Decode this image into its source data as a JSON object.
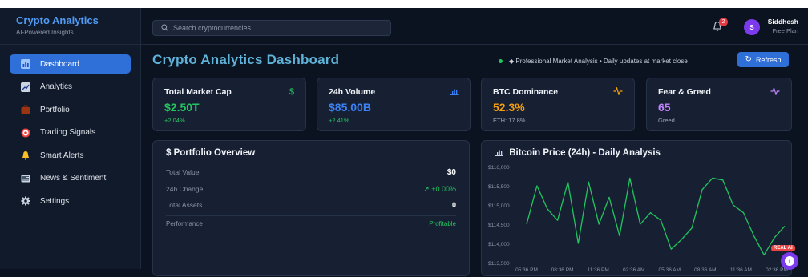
{
  "brand": {
    "title": "Crypto Analytics",
    "subtitle": "AI-Powered Insights"
  },
  "sidebar": {
    "items": [
      {
        "label": "Dashboard",
        "icon": "bar-chart-icon",
        "active": true
      },
      {
        "label": "Analytics",
        "icon": "trend-chart-icon"
      },
      {
        "label": "Portfolio",
        "icon": "briefcase-icon"
      },
      {
        "label": "Trading Signals",
        "icon": "target-icon"
      },
      {
        "label": "Smart Alerts",
        "icon": "bell-icon"
      },
      {
        "label": "News & Sentiment",
        "icon": "newspaper-icon"
      },
      {
        "label": "Settings",
        "icon": "gear-icon"
      }
    ]
  },
  "topbar": {
    "search_placeholder": "Search cryptocurrencies...",
    "notification_count": "2",
    "user": {
      "initial": "S",
      "name": "Siddhesh",
      "plan": "Free Plan"
    }
  },
  "header": {
    "title": "Crypto Analytics Dashboard",
    "market_note": "◆ Professional Market Analysis • Daily updates at market close",
    "refresh_label": "Refresh"
  },
  "stats": [
    {
      "title": "Total Market Cap",
      "icon": "dollar-icon",
      "value": "$2.50T",
      "sub": "+2.04%",
      "value_color": "#22c55e",
      "sub_color": "#22c55e",
      "icon_color": "#22c55e"
    },
    {
      "title": "24h Volume",
      "icon": "bar-chart-icon",
      "value": "$85.00B",
      "sub": "+2.41%",
      "value_color": "#3b82f6",
      "sub_color": "#22c55e",
      "icon_color": "#3b82f6"
    },
    {
      "title": "BTC Dominance",
      "icon": "activity-icon",
      "value": "52.3%",
      "sub": "ETH: 17.8%",
      "value_color": "#f59e0b",
      "sub_color": "#9aa4b6",
      "icon_color": "#f59e0b"
    },
    {
      "title": "Fear & Greed",
      "icon": "activity-icon",
      "value": "65",
      "sub": "Greed",
      "value_color": "#c084fc",
      "sub_color": "#9aa4b6",
      "icon_color": "#c084fc"
    }
  ],
  "portfolio": {
    "title": "$  Portfolio Overview",
    "rows": [
      {
        "label": "Total Value",
        "value": "$0"
      },
      {
        "label": "24h Change",
        "value": "↗ +0.00%"
      },
      {
        "label": "Total Assets",
        "value": "0"
      }
    ],
    "performance_label": "Performance",
    "performance_value": "Profitable"
  },
  "chart_data": {
    "type": "line",
    "title": "Bitcoin Price (24h) - Daily Analysis",
    "y_ticks": [
      "$116,000",
      "$115,500",
      "$115,000",
      "$114,500",
      "$114,000",
      "$113,500"
    ],
    "ylim": [
      113500,
      116000
    ],
    "x_ticks": [
      "05:36 PM",
      "08:36 PM",
      "11:36 PM",
      "02:36 AM",
      "05:36 AM",
      "08:36 AM",
      "11:36 AM",
      "02:36 PM"
    ],
    "series": [
      {
        "color": "#22c55e",
        "values": [
          114500,
          115500,
          114900,
          114600,
          115600,
          114000,
          115600,
          114500,
          115200,
          114200,
          115700,
          114500,
          114800,
          114600,
          113850,
          114100,
          114400,
          115400,
          115700,
          115650,
          115000,
          114800,
          114200,
          113700,
          114150,
          114450
        ]
      }
    ],
    "grid": false
  },
  "badge": {
    "label": "REAL AI"
  }
}
